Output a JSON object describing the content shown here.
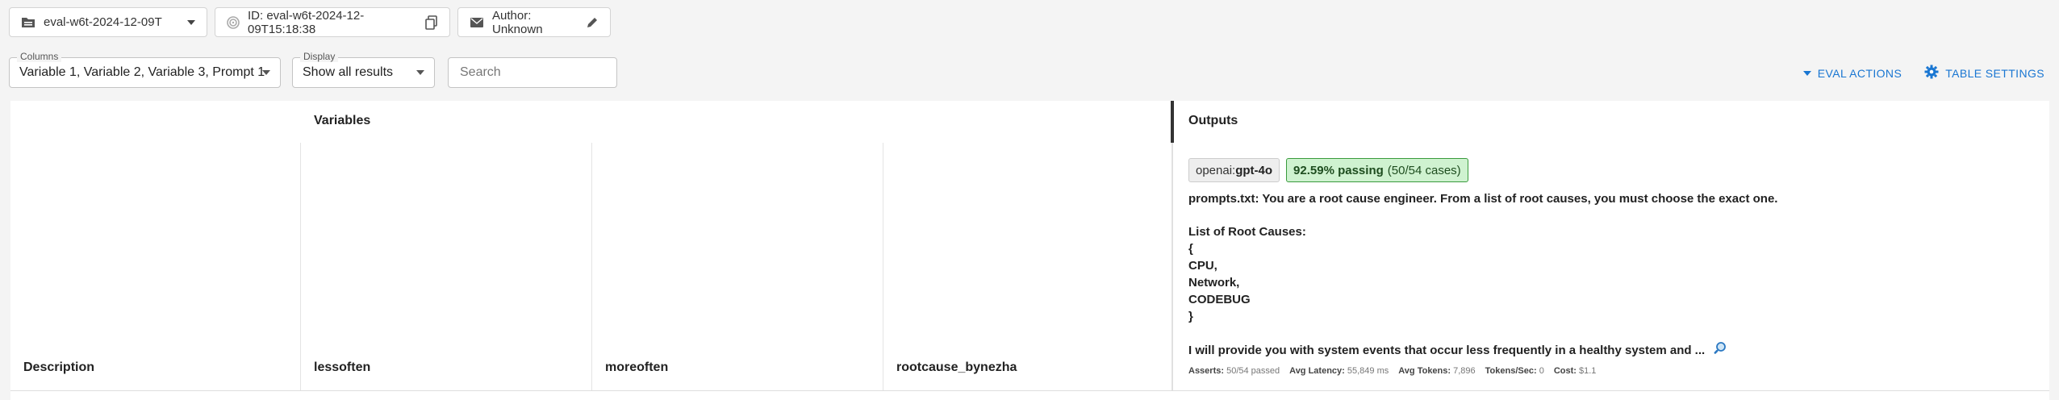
{
  "toolbar": {
    "eval_select": "eval-w6t-2024-12-09T",
    "id_label": "ID: eval-w6t-2024-12-09T15:18:38",
    "author_label": "Author: Unknown"
  },
  "filters": {
    "columns_legend": "Columns",
    "columns_value": "Variable 1, Variable 2, Variable 3, Prompt 1",
    "display_legend": "Display",
    "display_value": "Show all results",
    "search_placeholder": "Search"
  },
  "actions": {
    "eval_actions": "EVAL ACTIONS",
    "table_settings": "TABLE SETTINGS"
  },
  "table": {
    "variables_header": "Variables",
    "outputs_header": "Outputs",
    "columns": [
      "Description",
      "lessoften",
      "moreoften",
      "rootcause_bynezha"
    ],
    "provider_prefix": "openai:",
    "provider_model": "gpt-4o",
    "pass_rate": "92.59% passing",
    "pass_count": "(50/54 cases)",
    "prompt_lines": [
      "prompts.txt: You are a root cause engineer. From a list of root causes, you must choose the exact one.",
      "List of Root Causes:",
      "{",
      "CPU,",
      "Network,",
      "CODEBUG",
      "}",
      "I will provide you with system events that occur less frequently in a healthy system and ..."
    ],
    "stats": {
      "asserts_label": "Asserts:",
      "asserts_value": "50/54 passed",
      "latency_label": "Avg Latency:",
      "latency_value": "55,849 ms",
      "tokens_label": "Avg Tokens:",
      "tokens_value": "7,896",
      "tps_label": "Tokens/Sec:",
      "tps_value": "0",
      "cost_label": "Cost:",
      "cost_value": "$1.1"
    }
  }
}
